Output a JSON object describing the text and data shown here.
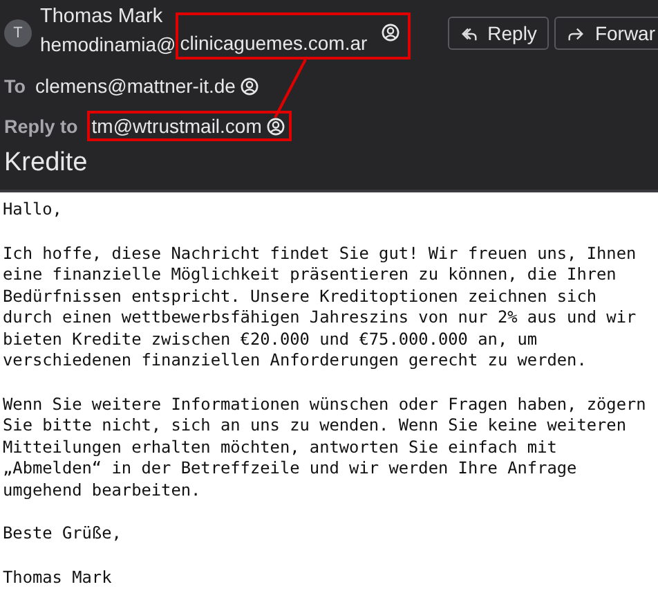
{
  "sender": {
    "avatar_initial": "T",
    "name": "Thomas Mark",
    "address_prefix": "hemodinamia@",
    "address_highlighted": "clinicaguemes.com.ar"
  },
  "buttons": [
    {
      "kind": "reply",
      "label": "Reply"
    },
    {
      "kind": "forward",
      "label": "Forwar"
    }
  ],
  "recipients": [
    {
      "label": "To",
      "address": "clemens@mattner-it.de",
      "highlighted": false
    },
    {
      "label": "Reply to",
      "address": "tm@wtrustmail.com",
      "highlighted": true
    }
  ],
  "subject": "Kredite",
  "body": [
    "Hallo,",
    "Ich hoffe, diese Nachricht findet Sie gut! Wir freuen uns, Ihnen\neine finanzielle Möglichkeit präsentieren zu können, die Ihren\nBedürfnissen entspricht. Unsere Kreditoptionen zeichnen sich\ndurch einen wettbewerbsfähigen Jahreszins von nur 2% aus und wir\nbieten Kredite zwischen €20.000 und €75.000.000 an, um\nverschiedenen finanziellen Anforderungen gerecht zu werden.",
    "Wenn Sie weitere Informationen wünschen oder Fragen haben, zögern\nSie bitte nicht, sich an uns zu wenden. Wenn Sie keine weiteren\nMitteilungen erhalten möchten, antworten Sie einfach mit\n„Abmelden“ in der Betreffzeile und wir werden Ihre Anfrage\numgehend bearbeiten.",
    "Beste Grüße,",
    "Thomas Mark"
  ]
}
